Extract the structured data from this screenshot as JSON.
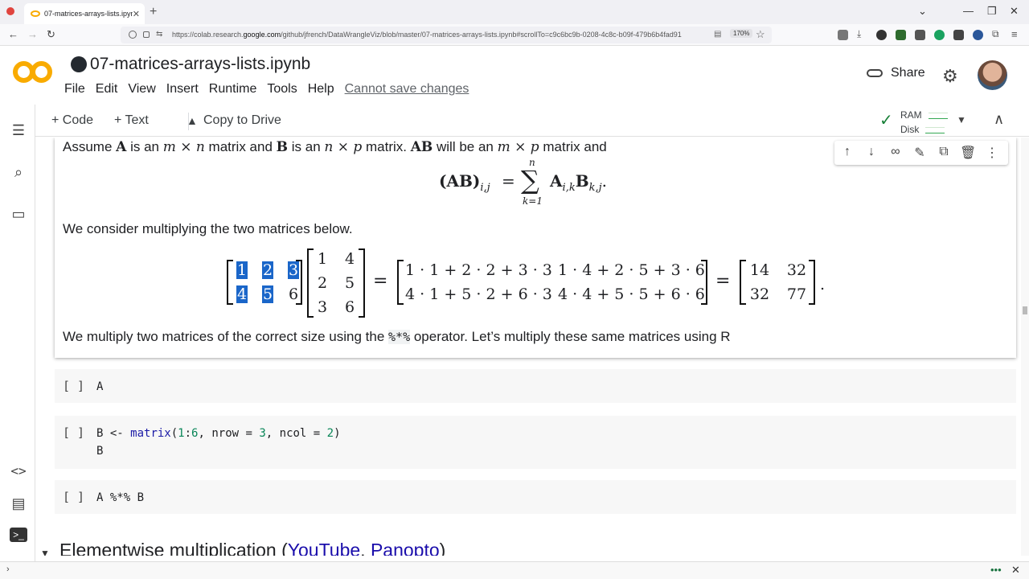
{
  "browser": {
    "tab_title": "07-matrices-arrays-lists.ipynb",
    "tab_close": "✕",
    "new_tab": "+",
    "url_prefix": "https://colab.research.",
    "url_domain": "google.com",
    "url_rest": "/github/jfrench/DataWrangleViz/blob/master/07-matrices-arrays-lists.ipynb#scrollTo=c9c6bc9b-0208-4c8c-b09f-479b6b4fad91",
    "zoom": "170%"
  },
  "colab": {
    "notebook_title": "07-matrices-arrays-lists.ipynb",
    "menu": [
      "File",
      "Edit",
      "View",
      "Insert",
      "Runtime",
      "Tools",
      "Help"
    ],
    "cannot_save": "Cannot save changes",
    "share_label": "Share",
    "add_code": "+ Code",
    "add_text": "+ Text",
    "copy_to_drive": "Copy to Drive",
    "ram_label": "RAM",
    "disk_label": "Disk"
  },
  "text_cell": {
    "line1_parts": [
      "Assume ",
      "A",
      " is an ",
      "m × n",
      " matrix and ",
      "B",
      " is an ",
      "n × p",
      " matrix. ",
      "AB",
      " will be an ",
      "m × p",
      " matrix and"
    ],
    "eq1_lhs": "(AB)",
    "eq1_sub": "i,j",
    "eq1_eq": "=",
    "eq1_sum": "∑",
    "eq1_sum_top": "n",
    "eq1_sum_bottom": "k=1",
    "eq1_rhs_a": "A",
    "eq1_rhs_a_sub": "i,k",
    "eq1_rhs_b": "B",
    "eq1_rhs_b_sub": "k,j",
    "eq1_end": ".",
    "line2": "We consider multiplying the two matrices below.",
    "matA": [
      "1",
      "2",
      "3",
      "4",
      "5",
      "6"
    ],
    "matB": [
      "1",
      "4",
      "2",
      "5",
      "3",
      "6"
    ],
    "matC": [
      "1 · 1 + 2 · 2 + 3 · 3",
      "1 · 4 + 2 · 5 + 3 · 6",
      "4 · 1 + 5 · 2 + 6 · 3",
      "4 · 4 + 5 · 5 + 6 · 6"
    ],
    "matD": [
      "14",
      "32",
      "32",
      "77"
    ],
    "eq_sign": "=",
    "eq2_end": ".",
    "line3_a": "We multiply two matrices of the correct size using the ",
    "line3_code": "%*%",
    "line3_b": " operator. Let’s multiply these same matrices using R"
  },
  "code_cells": [
    {
      "run": "[ ]",
      "line1": "A"
    },
    {
      "run": "[ ]",
      "line1_pre": "B <- ",
      "line1_fn": "matrix",
      "line1_a": "(",
      "line1_n1": "1",
      "line1_b": ":",
      "line1_n2": "6",
      "line1_c": ", nrow = ",
      "line1_n3": "3",
      "line1_d": ", ncol = ",
      "line1_n4": "2",
      "line1_e": ")",
      "line2": "B"
    },
    {
      "run": "[ ]",
      "line1": "A %*% B"
    }
  ],
  "section": {
    "title": "Elementwise multiplication (",
    "link1": "YouTube",
    "sep": ", ",
    "link2": "Panopto",
    "close": ")"
  },
  "colors": {
    "accent": "#f9ab00",
    "highlight": "#1a66c9",
    "link": "#1a0dab"
  }
}
